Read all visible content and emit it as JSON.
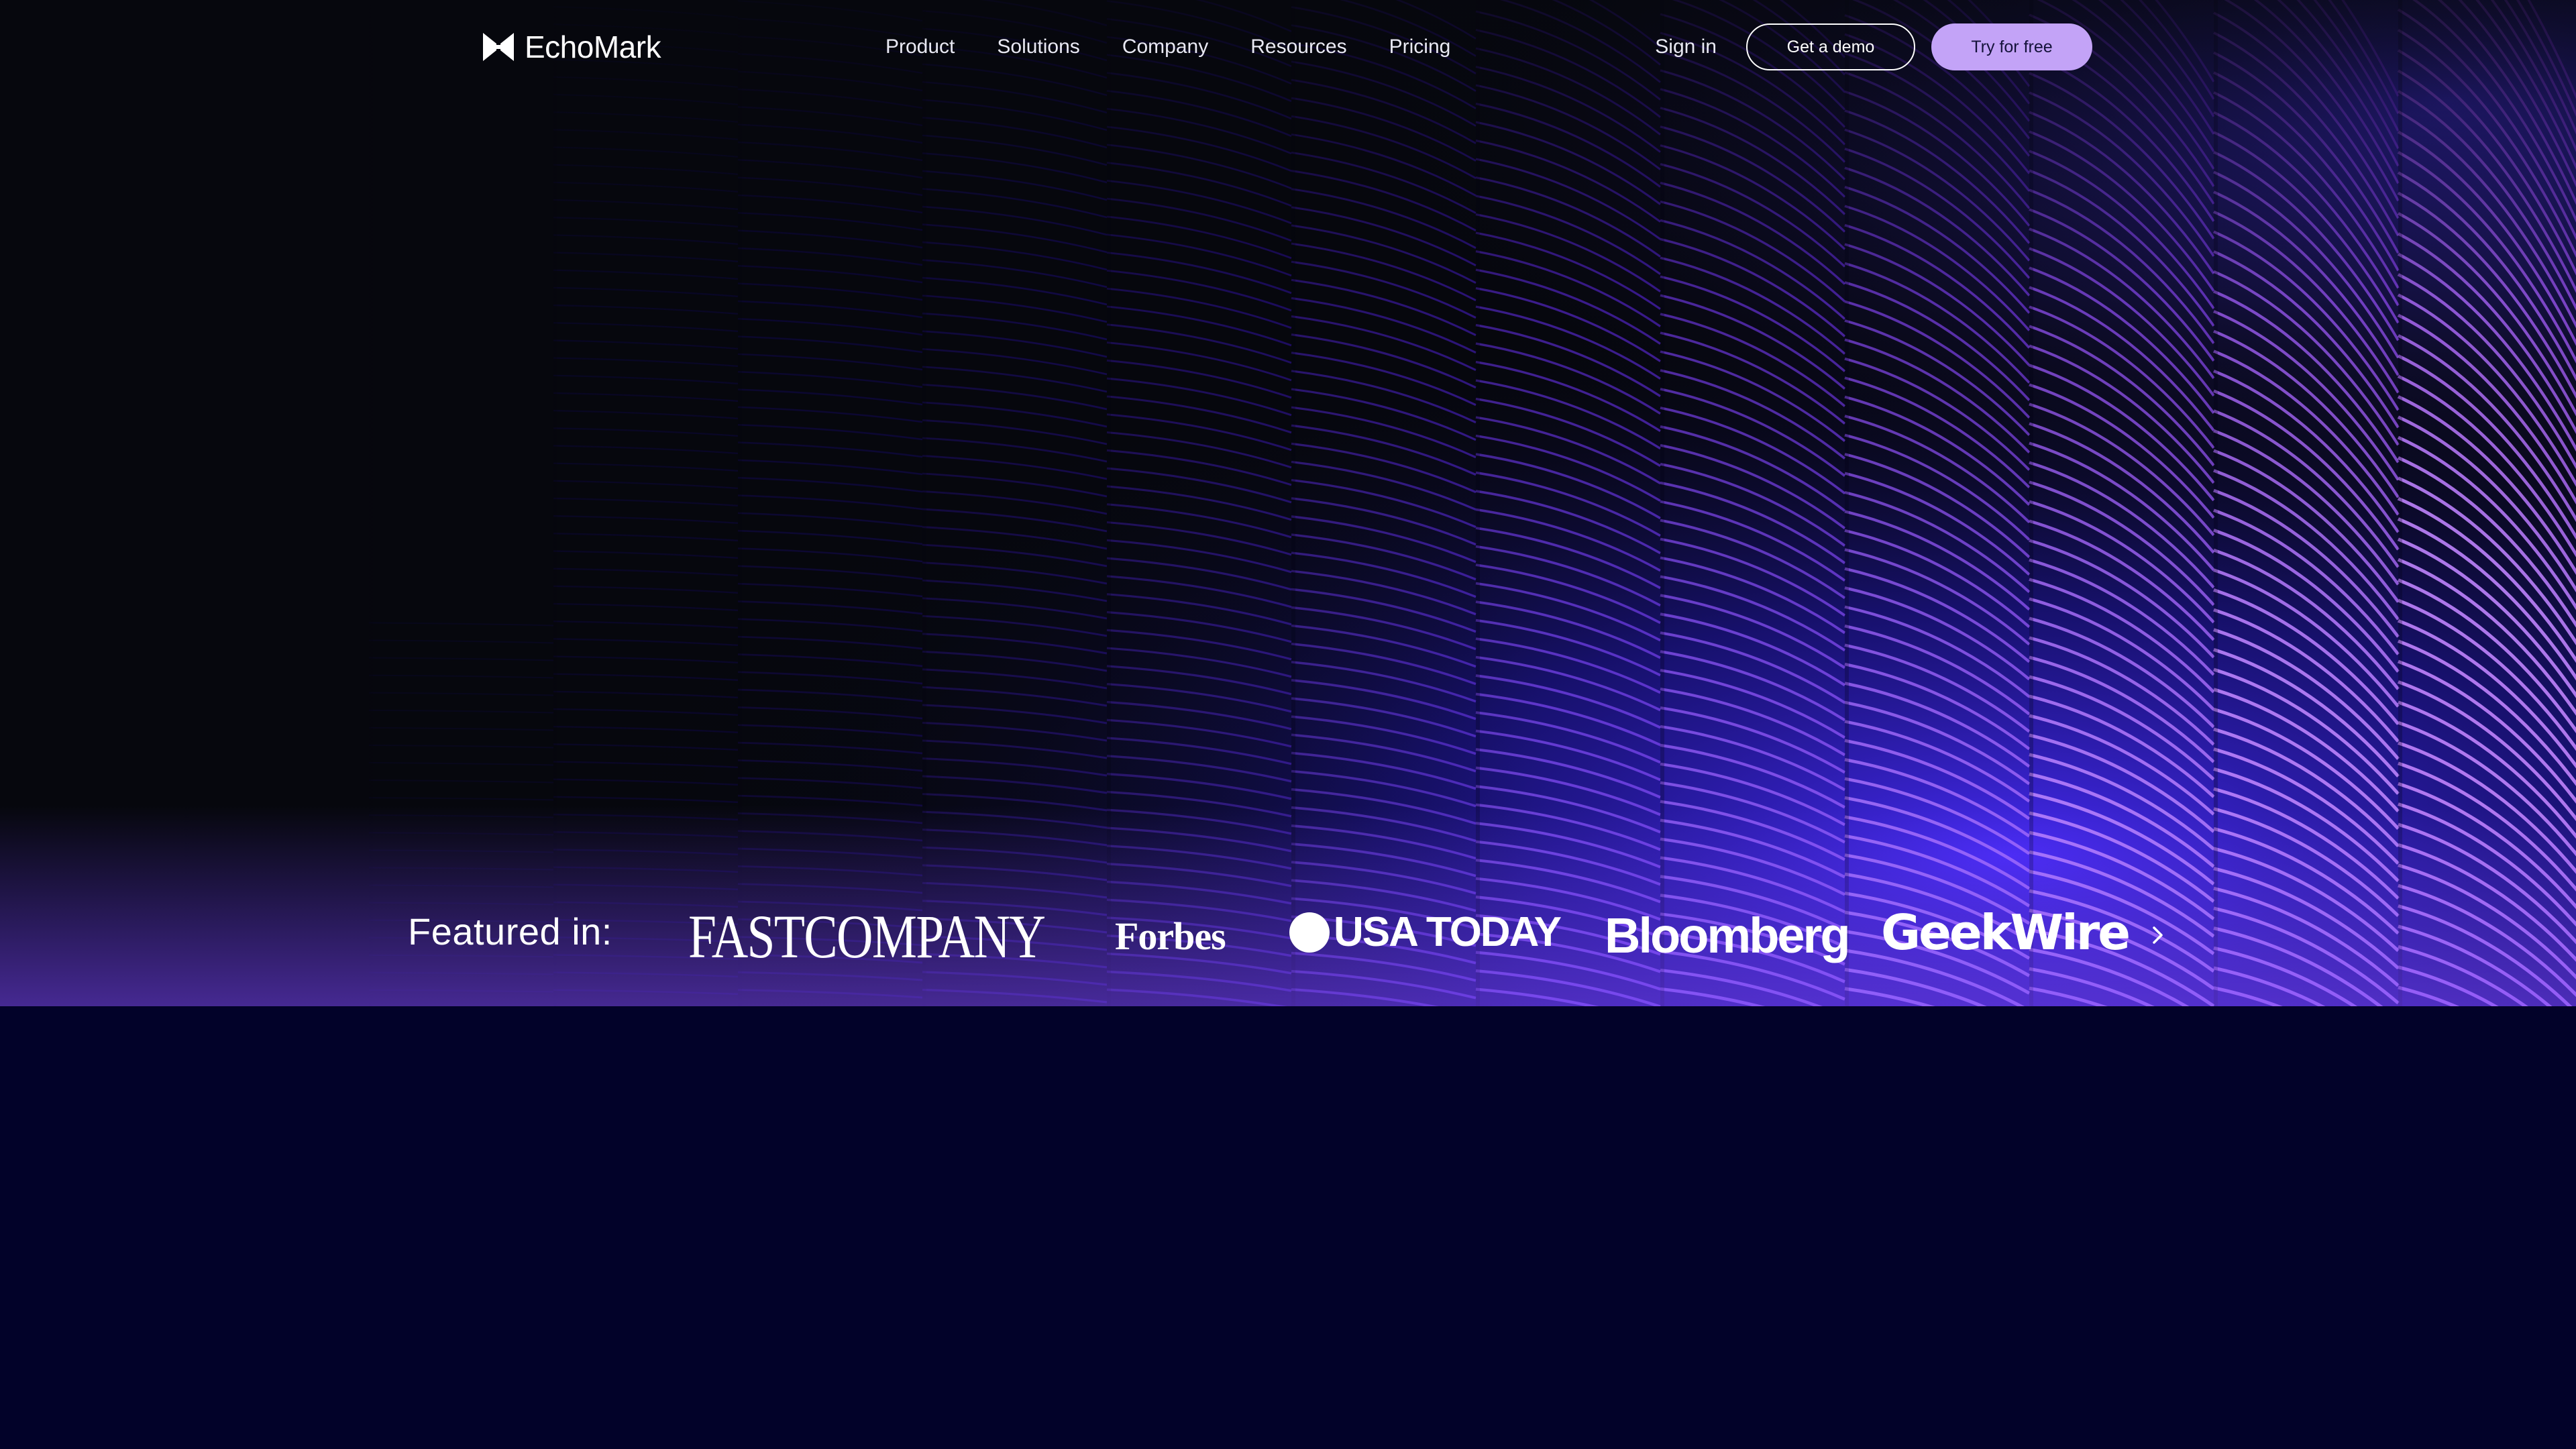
{
  "brand": {
    "name": "EchoMark",
    "logo_icon": "echomark-logo-icon"
  },
  "nav": {
    "links": [
      "Product",
      "Solutions",
      "Company",
      "Resources",
      "Pricing"
    ],
    "sign_in": "Sign in",
    "demo_button": "Get a demo",
    "trial_button": "Try for free"
  },
  "featured": {
    "label": "Featured in:",
    "outlets": [
      "FASTCOMPANY",
      "Forbes",
      "USA TODAY",
      "Bloomberg",
      "GeekWire"
    ],
    "next_icon": "chevron-right-icon"
  },
  "colors": {
    "background": "#020229",
    "accent": "#c3a3f7",
    "hero_blue": "#2a2bff",
    "hero_violet": "#8a5cff"
  }
}
